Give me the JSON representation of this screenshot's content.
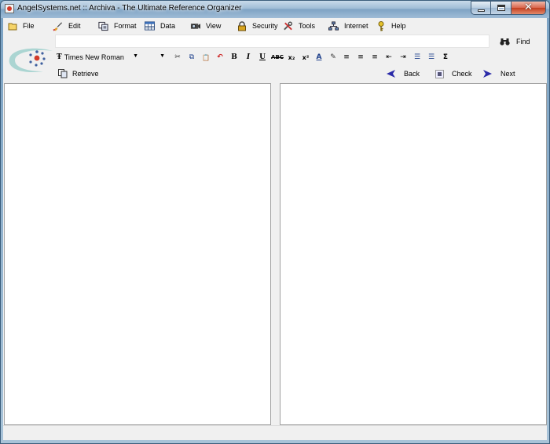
{
  "window": {
    "title": "AngelSystems.net :: Archiva - The Ultimate Reference Organizer",
    "close_glyph": "✕"
  },
  "menu": [
    {
      "label": "File",
      "icon": "folder-icon"
    },
    {
      "label": "Edit",
      "icon": "brush-icon"
    },
    {
      "label": "Format",
      "icon": "format-icon"
    },
    {
      "label": "Data",
      "icon": "table-icon"
    },
    {
      "label": "View",
      "icon": "camera-icon"
    },
    {
      "label": "Security",
      "icon": "lock-icon"
    },
    {
      "label": "Tools",
      "icon": "tools-icon"
    },
    {
      "label": "Internet",
      "icon": "network-icon"
    },
    {
      "label": "Help",
      "icon": "key-icon"
    }
  ],
  "address": {
    "value": ""
  },
  "find": {
    "label": "Find",
    "icon": "binoculars-icon"
  },
  "format_bar": {
    "font_name": "Times New Roman",
    "font_size": "",
    "buttons": [
      {
        "name": "cut-icon",
        "glyph": "✂"
      },
      {
        "name": "copy-icon",
        "glyph": "⧉"
      },
      {
        "name": "paste-icon",
        "glyph": "📋"
      },
      {
        "name": "undo-icon",
        "glyph": "↶"
      },
      {
        "name": "bold-button",
        "glyph": "B"
      },
      {
        "name": "italic-button",
        "glyph": "I"
      },
      {
        "name": "underline-button",
        "glyph": "U"
      },
      {
        "name": "strikethrough-button",
        "glyph": "ABC"
      },
      {
        "name": "subscript-button",
        "glyph": "x₂"
      },
      {
        "name": "superscript-button",
        "glyph": "x²"
      },
      {
        "name": "font-color-icon",
        "glyph": "A"
      },
      {
        "name": "highlight-icon",
        "glyph": "✎"
      },
      {
        "name": "align-left-icon",
        "glyph": "≡"
      },
      {
        "name": "align-center-icon",
        "glyph": "≡"
      },
      {
        "name": "align-right-icon",
        "glyph": "≡"
      },
      {
        "name": "outdent-icon",
        "glyph": "⇤"
      },
      {
        "name": "indent-icon",
        "glyph": "⇥"
      },
      {
        "name": "bullet-list-icon",
        "glyph": "☰"
      },
      {
        "name": "numbered-list-icon",
        "glyph": "☰"
      },
      {
        "name": "sum-icon",
        "glyph": "Σ"
      }
    ]
  },
  "actions": {
    "retrieve": "Retrieve",
    "back": "Back",
    "check": "Check",
    "next": "Next"
  },
  "colors": {
    "accent_blue": "#2a2aa8",
    "logo_red": "#d23a2a",
    "logo_teal": "#6fb6b0"
  }
}
